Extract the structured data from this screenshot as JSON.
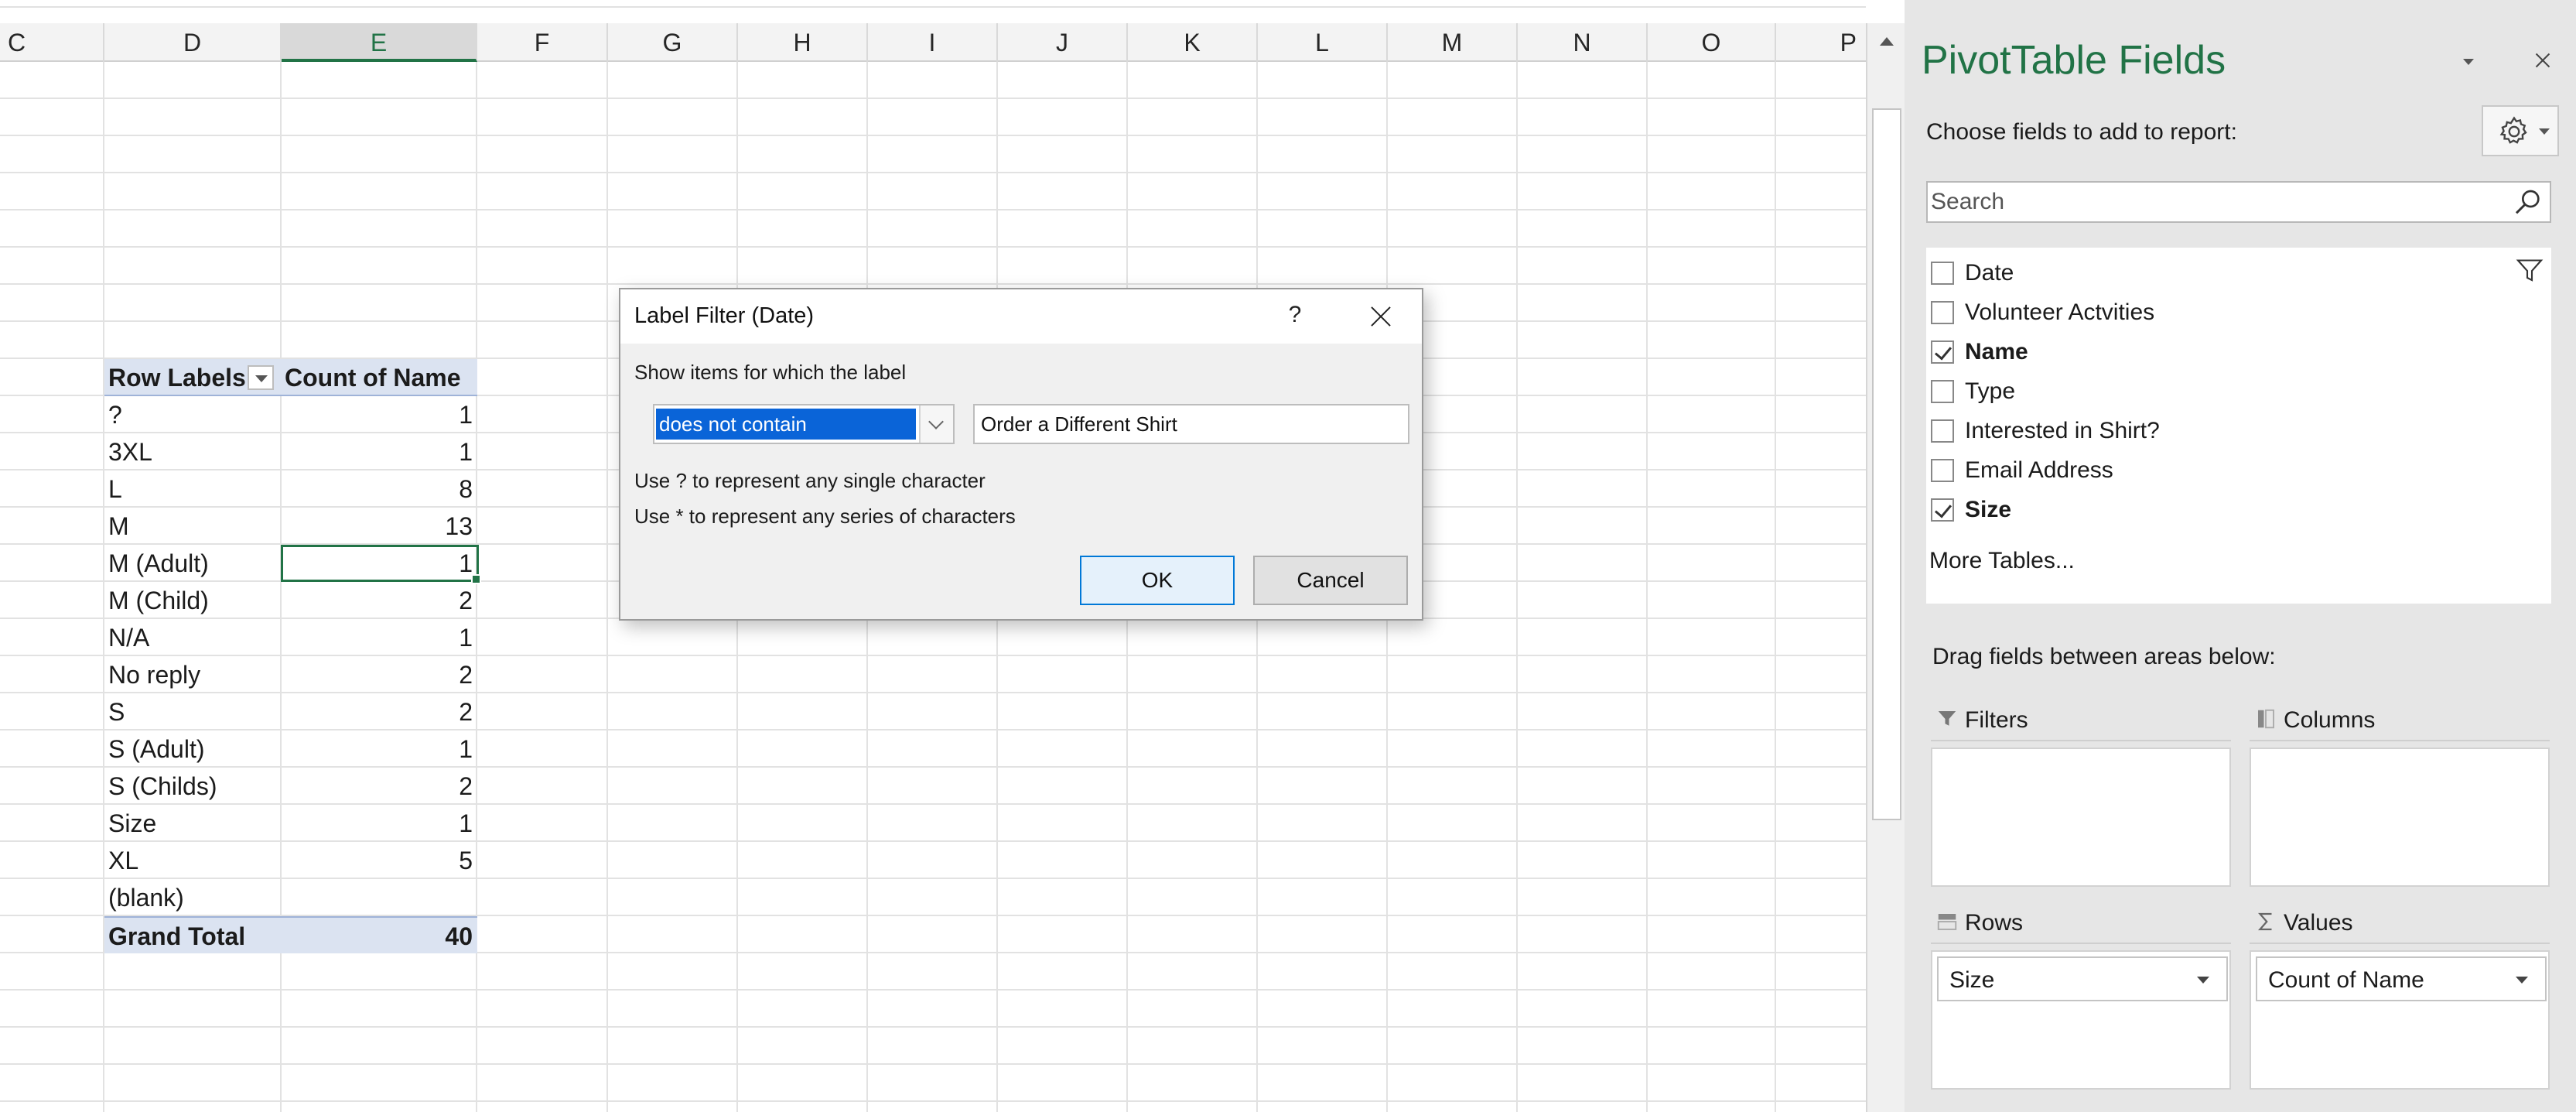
{
  "sheet": {
    "columns": [
      "C",
      "D",
      "E",
      "F",
      "G",
      "H",
      "I",
      "J",
      "K",
      "L",
      "M",
      "N",
      "O",
      "P"
    ],
    "selected_column": "E",
    "pivot": {
      "header_label": "Row Labels",
      "header_value": "Count of Name",
      "rows": [
        {
          "label": "?",
          "value": "1"
        },
        {
          "label": "3XL",
          "value": "1"
        },
        {
          "label": "L",
          "value": "8"
        },
        {
          "label": "M",
          "value": "13"
        },
        {
          "label": "M (Adult)",
          "value": "1"
        },
        {
          "label": "M (Child)",
          "value": "2"
        },
        {
          "label": "N/A",
          "value": "1"
        },
        {
          "label": "No reply",
          "value": "2"
        },
        {
          "label": "S",
          "value": "2"
        },
        {
          "label": "S (Adult)",
          "value": "1"
        },
        {
          "label": "S (Childs)",
          "value": "2"
        },
        {
          "label": "Size",
          "value": "1"
        },
        {
          "label": "XL",
          "value": "5"
        },
        {
          "label": "(blank)",
          "value": ""
        }
      ],
      "total_label": "Grand Total",
      "total_value": "40"
    }
  },
  "dialog": {
    "title": "Label Filter (Date)",
    "help": "?",
    "show_label": "Show items for which the label",
    "operator": "does not contain",
    "value": "Order a Different Shirt",
    "hint1": "Use ? to represent any single character",
    "hint2": "Use * to represent any series of characters",
    "ok": "OK",
    "cancel": "Cancel"
  },
  "pane": {
    "title": "PivotTable Fields",
    "choose": "Choose fields to add to report:",
    "search_placeholder": "Search",
    "fields": [
      {
        "label": "Date",
        "checked": false
      },
      {
        "label": "Volunteer Actvities",
        "checked": false
      },
      {
        "label": "Name",
        "checked": true
      },
      {
        "label": "Type",
        "checked": false
      },
      {
        "label": "Interested in Shirt?",
        "checked": false
      },
      {
        "label": "Email Address",
        "checked": false
      },
      {
        "label": "Size",
        "checked": true
      }
    ],
    "more_tables": "More Tables...",
    "drag_label": "Drag fields between areas below:",
    "areas": {
      "filters": {
        "title": "Filters",
        "item": ""
      },
      "columns": {
        "title": "Columns",
        "item": ""
      },
      "rows": {
        "title": "Rows",
        "item": "Size"
      },
      "values": {
        "title": "Values",
        "item": "Count of Name"
      }
    }
  },
  "colors": {
    "accent": "#217346",
    "selection": "#0a64d8",
    "pivot_header": "#dbe3f1"
  }
}
